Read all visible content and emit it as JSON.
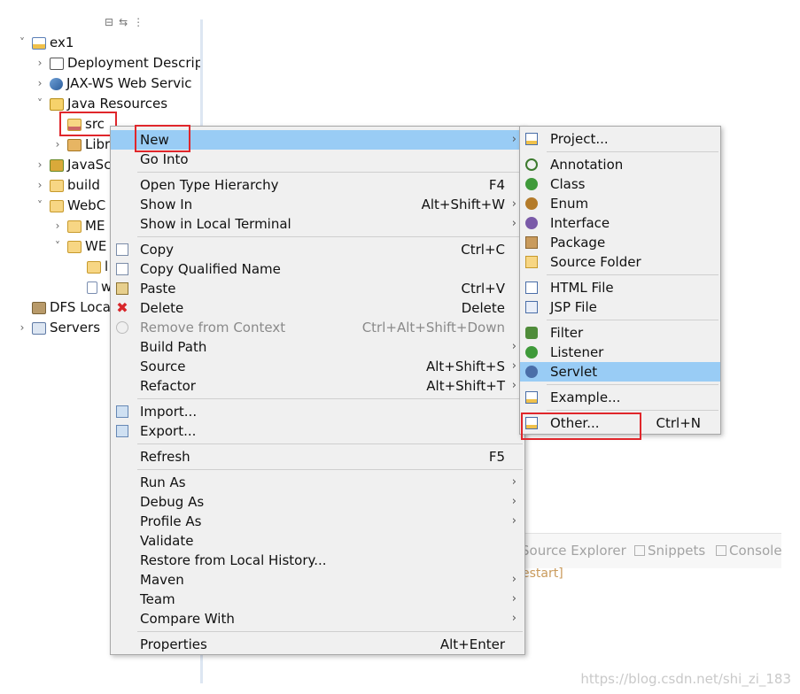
{
  "tree": {
    "items": [
      {
        "label": "ex1",
        "chevron": "˅",
        "icon": "web-project-icon"
      },
      {
        "label": "Deployment Descrip",
        "chevron": "›",
        "icon": "deployment-descriptor-icon"
      },
      {
        "label": "JAX-WS Web Servic",
        "chevron": "›",
        "icon": "jaxws-icon"
      },
      {
        "label": "Java Resources",
        "chevron": "˅",
        "icon": "java-resources-icon"
      },
      {
        "label": "src",
        "chevron": "",
        "icon": "source-folder-icon"
      },
      {
        "label": "Libr",
        "chevron": "›",
        "icon": "library-icon"
      },
      {
        "label": "JavaSc",
        "chevron": "›",
        "icon": "javascript-resources-icon"
      },
      {
        "label": "build",
        "chevron": "›",
        "icon": "folder-icon"
      },
      {
        "label": "WebC",
        "chevron": "˅",
        "icon": "folder-icon"
      },
      {
        "label": "ME",
        "chevron": "›",
        "icon": "folder-icon"
      },
      {
        "label": "WE",
        "chevron": "˅",
        "icon": "folder-icon"
      },
      {
        "label": "l",
        "chevron": "",
        "icon": "folder-icon"
      },
      {
        "label": "w",
        "chevron": "",
        "icon": "xml-file-icon"
      },
      {
        "label": "DFS Loca",
        "chevron": "",
        "icon": "dfs-location-icon"
      },
      {
        "label": "Servers",
        "chevron": "›",
        "icon": "servers-icon"
      }
    ]
  },
  "context_menu": {
    "items": [
      {
        "label": "New",
        "accel": "",
        "submenu": true
      },
      {
        "label": "Go Into",
        "accel": "",
        "submenu": false
      },
      {
        "label": "Open Type Hierarchy",
        "accel": "F4",
        "submenu": false
      },
      {
        "label": "Show In",
        "accel": "Alt+Shift+W",
        "submenu": true
      },
      {
        "label": "Show in Local Terminal",
        "accel": "",
        "submenu": true
      },
      {
        "label": "Copy",
        "accel": "Ctrl+C",
        "submenu": false,
        "icon": "copy-icon"
      },
      {
        "label": "Copy Qualified Name",
        "accel": "",
        "submenu": false,
        "icon": "copy-qualified-name-icon"
      },
      {
        "label": "Paste",
        "accel": "Ctrl+V",
        "submenu": false,
        "icon": "paste-icon"
      },
      {
        "label": "Delete",
        "accel": "Delete",
        "submenu": false,
        "icon": "delete-icon"
      },
      {
        "label": "Remove from Context",
        "accel": "Ctrl+Alt+Shift+Down",
        "submenu": false,
        "disabled": true,
        "icon": "remove-context-icon"
      },
      {
        "label": "Build Path",
        "accel": "",
        "submenu": true
      },
      {
        "label": "Source",
        "accel": "Alt+Shift+S",
        "submenu": true
      },
      {
        "label": "Refactor",
        "accel": "Alt+Shift+T",
        "submenu": true
      },
      {
        "label": "Import...",
        "accel": "",
        "submenu": false,
        "icon": "import-icon"
      },
      {
        "label": "Export...",
        "accel": "",
        "submenu": false,
        "icon": "export-icon"
      },
      {
        "label": "Refresh",
        "accel": "F5",
        "submenu": false
      },
      {
        "label": "Run As",
        "accel": "",
        "submenu": true
      },
      {
        "label": "Debug As",
        "accel": "",
        "submenu": true
      },
      {
        "label": "Profile As",
        "accel": "",
        "submenu": true
      },
      {
        "label": "Validate",
        "accel": "",
        "submenu": false
      },
      {
        "label": "Restore from Local History...",
        "accel": "",
        "submenu": false
      },
      {
        "label": "Maven",
        "accel": "",
        "submenu": true
      },
      {
        "label": "Team",
        "accel": "",
        "submenu": true
      },
      {
        "label": "Compare With",
        "accel": "",
        "submenu": true
      },
      {
        "label": "Properties",
        "accel": "Alt+Enter",
        "submenu": false
      }
    ]
  },
  "new_submenu": {
    "items": [
      {
        "label": "Project...",
        "accel": "",
        "icon": "new-project-icon"
      },
      {
        "label": "Annotation",
        "accel": "",
        "icon": "annotation-icon"
      },
      {
        "label": "Class",
        "accel": "",
        "icon": "class-icon"
      },
      {
        "label": "Enum",
        "accel": "",
        "icon": "enum-icon"
      },
      {
        "label": "Interface",
        "accel": "",
        "icon": "interface-icon"
      },
      {
        "label": "Package",
        "accel": "",
        "icon": "package-icon"
      },
      {
        "label": "Source Folder",
        "accel": "",
        "icon": "source-folder-icon"
      },
      {
        "label": "HTML File",
        "accel": "",
        "icon": "html-file-icon"
      },
      {
        "label": "JSP File",
        "accel": "",
        "icon": "jsp-file-icon"
      },
      {
        "label": "Filter",
        "accel": "",
        "icon": "filter-icon"
      },
      {
        "label": "Listener",
        "accel": "",
        "icon": "listener-icon"
      },
      {
        "label": "Servlet",
        "accel": "",
        "icon": "servlet-icon"
      },
      {
        "label": "Example...",
        "accel": "",
        "icon": "example-icon"
      },
      {
        "label": "Other...",
        "accel": "Ctrl+N",
        "icon": "other-wizard-icon"
      }
    ]
  },
  "bottom_panel": {
    "tabs": [
      {
        "label": "Source Explorer"
      },
      {
        "label": "Snippets"
      },
      {
        "label": "Console"
      }
    ],
    "console_text": "estart]"
  },
  "watermark": "https://blog.csdn.net/shi_zi_183",
  "colors": {
    "menu_highlight": "#99ccf5",
    "annotation_red": "#e0262b"
  }
}
